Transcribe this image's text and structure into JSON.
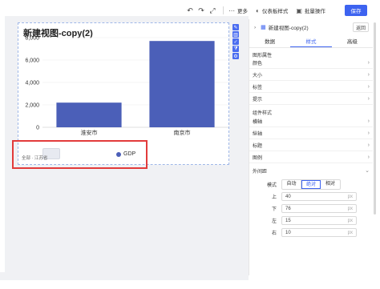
{
  "toolbar": {
    "undo_icon": "undo-icon",
    "redo_icon": "redo-icon",
    "expand_icon": "expand-icon",
    "more_label": "更多",
    "style_label": "仪表板样式",
    "batch_label": "批量操作",
    "save_label": "保存"
  },
  "widget": {
    "title": "新建视图-copy(2)",
    "legend_label": "GDP",
    "filter_text": "全部 · 江苏省"
  },
  "chart_data": {
    "type": "bar",
    "categories": [
      "淮安市",
      "南京市"
    ],
    "series": [
      {
        "name": "GDP",
        "values": [
          2200,
          7700
        ]
      }
    ],
    "yticks": [
      "0",
      "2,000",
      "4,000",
      "6,000",
      "8,000"
    ],
    "ylim": [
      0,
      8000
    ],
    "color": "#4b5fb8",
    "grid": true
  },
  "panel": {
    "header_title": "新建视图-copy(2)",
    "back_label": "返回",
    "tabs": [
      "数据",
      "样式",
      "高级"
    ],
    "active_tab": "样式",
    "graph_group": "图形属性",
    "graph_items": [
      "颜色",
      "大小",
      "标签",
      "提示"
    ],
    "component_group": "组件样式",
    "component_items": [
      "横轴",
      "纵轴",
      "标题",
      "图例"
    ],
    "margin_label": "外间距",
    "mode_label": "模式",
    "mode_options": [
      "自动",
      "绝对",
      "相对"
    ],
    "mode_selected": "绝对",
    "margins": [
      {
        "label": "上",
        "value": "40",
        "unit": "px"
      },
      {
        "label": "下",
        "value": "76",
        "unit": "px"
      },
      {
        "label": "左",
        "value": "15",
        "unit": "px"
      },
      {
        "label": "右",
        "value": "10",
        "unit": "px"
      }
    ]
  }
}
